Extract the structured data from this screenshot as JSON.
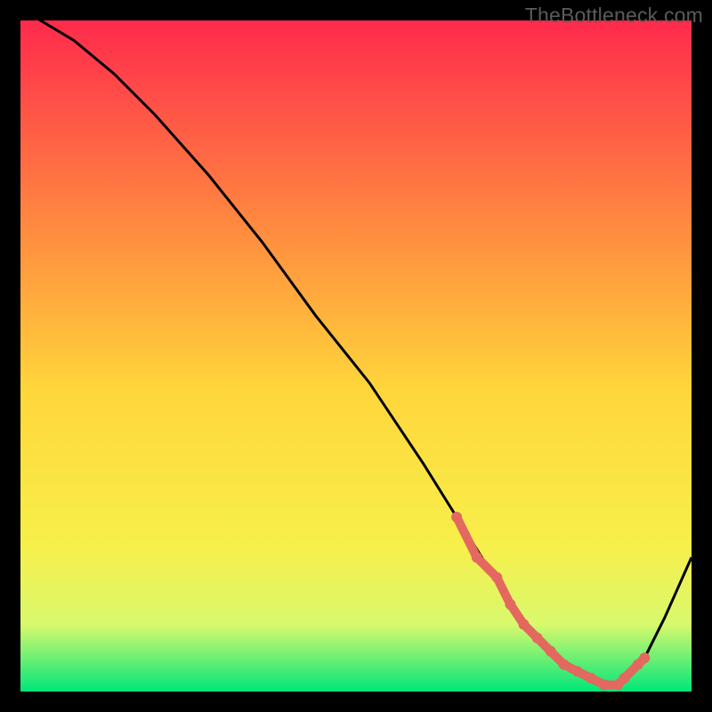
{
  "watermark": "TheBottleneck.com",
  "colors": {
    "page_bg": "#000000",
    "grad_top": "#ff2a4c",
    "grad_mid_upper": "#ff8e3f",
    "grad_mid": "#ffd63b",
    "grad_mid_lower": "#f7ef4a",
    "grad_lower": "#d9f96d",
    "grad_bottom": "#00e67a",
    "curve": "#000000",
    "marker": "#e3685f"
  },
  "chart_data": {
    "type": "line",
    "title": "",
    "xlabel": "",
    "ylabel": "",
    "xlim": [
      0,
      100
    ],
    "ylim": [
      0,
      100
    ],
    "legend": false,
    "grid": false,
    "series": [
      {
        "name": "bottleneck-curve",
        "x": [
          0,
          3,
          8,
          14,
          20,
          28,
          36,
          44,
          52,
          60,
          65,
          70,
          74,
          78,
          82,
          86,
          88,
          90,
          93,
          96,
          100
        ],
        "y": [
          102,
          100,
          97,
          92,
          86,
          77,
          67,
          56,
          46,
          34,
          26,
          18,
          12,
          7,
          3,
          1,
          1,
          2,
          5,
          11,
          20
        ]
      }
    ],
    "markers": {
      "name": "accent-points",
      "x": [
        65,
        68,
        71,
        73,
        75,
        77,
        79,
        81,
        83,
        85,
        87,
        89,
        90,
        92,
        93
      ],
      "y": [
        26,
        20,
        17,
        13,
        10,
        8,
        6,
        4,
        3,
        2,
        1,
        1,
        2,
        4,
        5
      ]
    }
  }
}
